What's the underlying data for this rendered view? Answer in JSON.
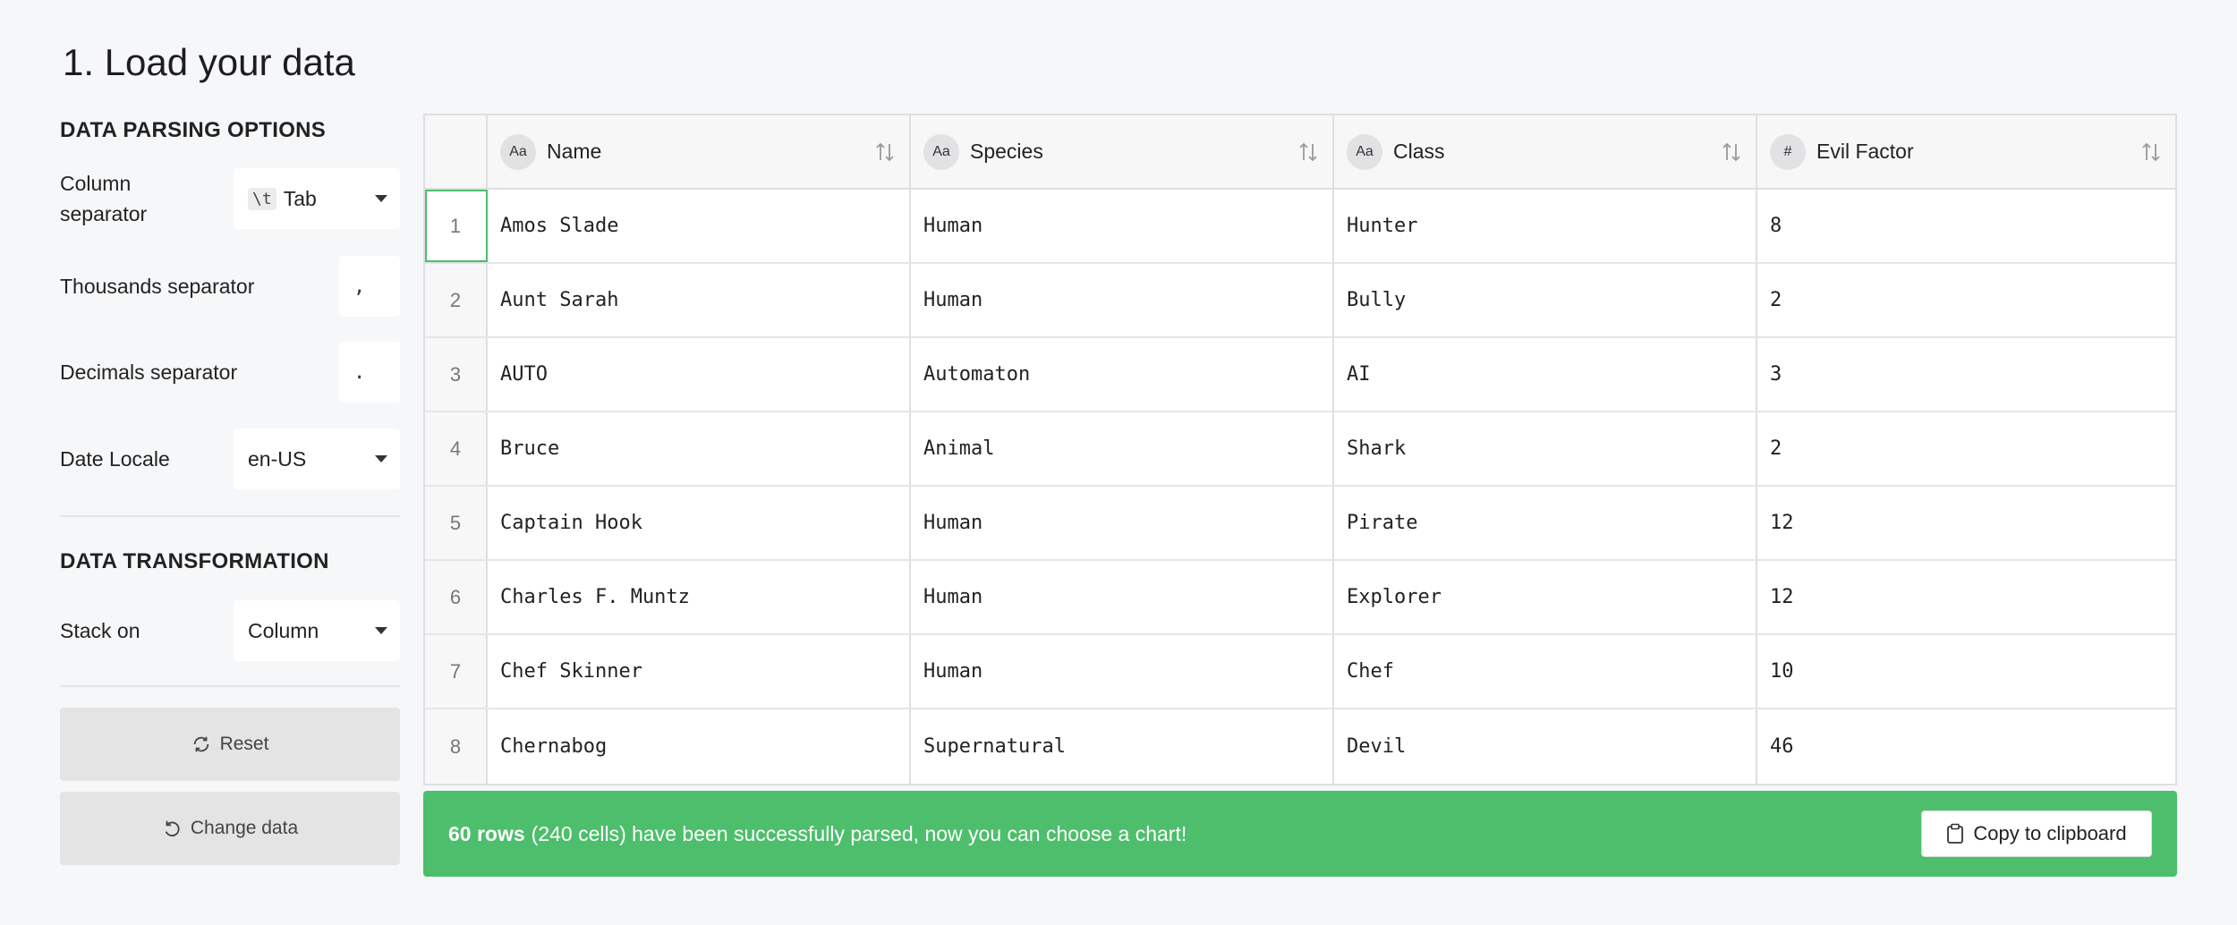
{
  "page": {
    "title": "1. Load your data"
  },
  "parsing": {
    "section_title": "DATA PARSING OPTIONS",
    "column_separator": {
      "label": "Column separator",
      "code": "\\t",
      "value": "Tab"
    },
    "thousands_separator": {
      "label": "Thousands separator",
      "value": ","
    },
    "decimals_separator": {
      "label": "Decimals separator",
      "value": "."
    },
    "date_locale": {
      "label": "Date Locale",
      "value": "en-US"
    }
  },
  "transformation": {
    "section_title": "DATA TRANSFORMATION",
    "stack_on": {
      "label": "Stack on",
      "value": "Column"
    }
  },
  "buttons": {
    "reset": "Reset",
    "change_data": "Change data"
  },
  "table": {
    "columns": [
      {
        "type": "Aa",
        "name": "Name"
      },
      {
        "type": "Aa",
        "name": "Species"
      },
      {
        "type": "Aa",
        "name": "Class"
      },
      {
        "type": "#",
        "name": "Evil Factor"
      }
    ],
    "rows": [
      {
        "num": "1",
        "cells": [
          "Amos Slade",
          "Human",
          "Hunter",
          "8"
        ]
      },
      {
        "num": "2",
        "cells": [
          "Aunt Sarah",
          "Human",
          "Bully",
          "2"
        ]
      },
      {
        "num": "3",
        "cells": [
          "AUTO",
          "Automaton",
          "AI",
          "3"
        ]
      },
      {
        "num": "4",
        "cells": [
          "Bruce",
          "Animal",
          "Shark",
          "2"
        ]
      },
      {
        "num": "5",
        "cells": [
          "Captain Hook",
          "Human",
          "Pirate",
          "12"
        ]
      },
      {
        "num": "6",
        "cells": [
          "Charles F. Muntz",
          "Human",
          "Explorer",
          "12"
        ]
      },
      {
        "num": "7",
        "cells": [
          "Chef Skinner",
          "Human",
          "Chef",
          "10"
        ]
      },
      {
        "num": "8",
        "cells": [
          "Chernabog",
          "Supernatural",
          "Devil",
          "46"
        ]
      }
    ]
  },
  "banner": {
    "rows_count": "60 rows",
    "message": "(240 cells) have been successfully parsed, now you can choose a chart!",
    "copy_label": "Copy to clipboard"
  }
}
